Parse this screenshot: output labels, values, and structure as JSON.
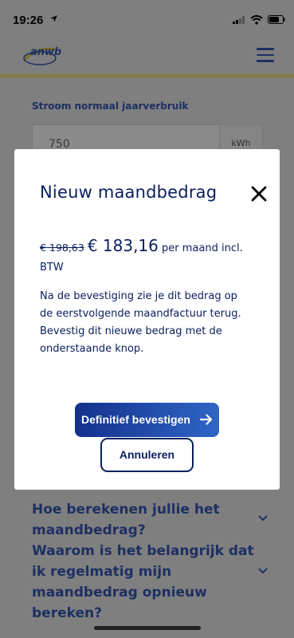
{
  "status": {
    "time": "19:26"
  },
  "header": {
    "logo_text": "anwb"
  },
  "form": {
    "label": "Stroom normaal jaarverbruik",
    "value": "750",
    "unit": "kWh"
  },
  "faq": [
    {
      "question": "Hoe berekenen jullie het maandbedrag?"
    },
    {
      "question": "Waarom is het belangrijk dat ik regelmatig mijn maandbedrag opnieuw bereken?"
    }
  ],
  "modal": {
    "title": "Nieuw maandbedrag",
    "old_price": "€ 198,63",
    "new_price": "€ 183,16",
    "price_suffix": "per maand incl. BTW",
    "body": "Na de bevestiging zie je dit bedrag op de eerstvolgende maandfactuur terug. Bevestig dit nieuwe bedrag met de onderstaande knop.",
    "confirm_label": "Definitief bevestigen",
    "cancel_label": "Annuleren"
  },
  "colors": {
    "primary": "#0a1f5e",
    "accent_start": "#14318c",
    "accent_end": "#2f66c6",
    "brand_yellow": "#ffd400"
  },
  "icons": [
    "location-arrow-icon",
    "signal-icon",
    "wifi-icon",
    "battery-icon",
    "menu-icon",
    "close-icon",
    "arrow-right-icon",
    "chevron-down-icon"
  ]
}
